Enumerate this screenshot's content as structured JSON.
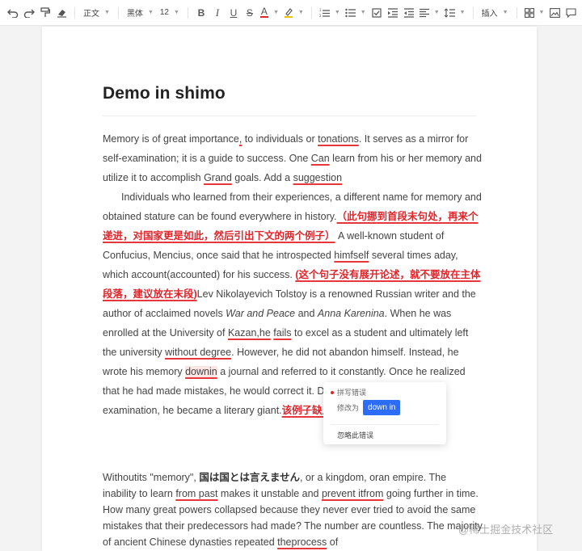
{
  "toolbar": {
    "paragraph_style": "正文",
    "font_family": "黑体",
    "font_size": "12",
    "bold": "B",
    "italic": "I",
    "underline": "U",
    "strike": "S",
    "text_color": "A",
    "insert": "插入",
    "icons": [
      "undo-icon",
      "redo-icon",
      "format-painter-icon",
      "eraser-icon",
      "highlight-icon",
      "ordered-list-icon",
      "bullet-list-icon",
      "checklist-icon",
      "indent-icon",
      "outdent-icon",
      "align-icon",
      "line-height-icon",
      "table-icon",
      "image-icon",
      "comment-icon"
    ]
  },
  "document": {
    "title": "Demo in shimo",
    "p1": {
      "a": "Memory is of great importance",
      "a_err": ",",
      "b": " to individuals or ",
      "b_err": "tonations",
      "c": ". It serves as a mirror for self-examination; it is a guide to success. One ",
      "c_err": "Can",
      "d": " learn from his or her memory and utilize it to accomplish ",
      "d_err": "Grand",
      "e": " goals. Add a ",
      "e_err": "suggestion"
    },
    "p2": {
      "a": "Individuals who learned from their experiences, a different name for memory and obtained stature can be found everywhere in history.",
      "note1": "（此句挪到首段末句处，再来个递进，对国家更是如此，然后引出下文的两个例子）",
      "b": " A well-known student of Confucius, Mencius, once said that he introspected ",
      "b_err": "himfself",
      "c": " several times aday, which account(accounted) for his success. ",
      "note2": "(这个句子没有展开论述，就不要放在主体段落，建议放在末段)",
      "d": "Lev Nikolayevich Tolstoy is a renowned Russian writer and the author of acclaimed novels ",
      "novel1": "War and Peace",
      "e": " and ",
      "novel2": "Anna Karenina",
      "f": ". When he was enrolled at the University of ",
      "f_err": "Kazan,he",
      "g": " ",
      "g_err": "fails",
      "h": " to excel as a student and ultimately left the university ",
      "h_err": "without degree",
      "i": ". However, he did not abandon himself. Instead, he wrote his memory ",
      "i_err": "downin",
      "j": " a journal and referred to it constantly. Once he realized that he had made mistakes, he would correct it. During the process of re-examination, he became a literary giant.",
      "note3": "该例子缺乏议论，建议补充。"
    },
    "p3": {
      "a": "Withoutits \"memory\", ",
      "cjk": "国は国とは言えません",
      "b": ", or a kingdom, oran empire. The inability to learn ",
      "b_err": "from past",
      "c": " makes it unstable and ",
      "c_err": "prevent itfrom",
      "d": " going further in time. How many great powers collapsed because they never ever tried to avoid the same mistakes that their predecessors had made? The number are countless. The majority of ancient Chinese dynasties repeated ",
      "d_err": "theprocess",
      "e": " of"
    }
  },
  "spell_popup": {
    "header": "拼写错误",
    "change_label": "修改为",
    "suggestion": "down in",
    "ignore": "忽略此错误"
  },
  "watermark": "@稀土掘金技术社区",
  "colors": {
    "error_underline": "#e8373b",
    "note_text": "#e0252b",
    "primary_button": "#2d6cf6"
  }
}
